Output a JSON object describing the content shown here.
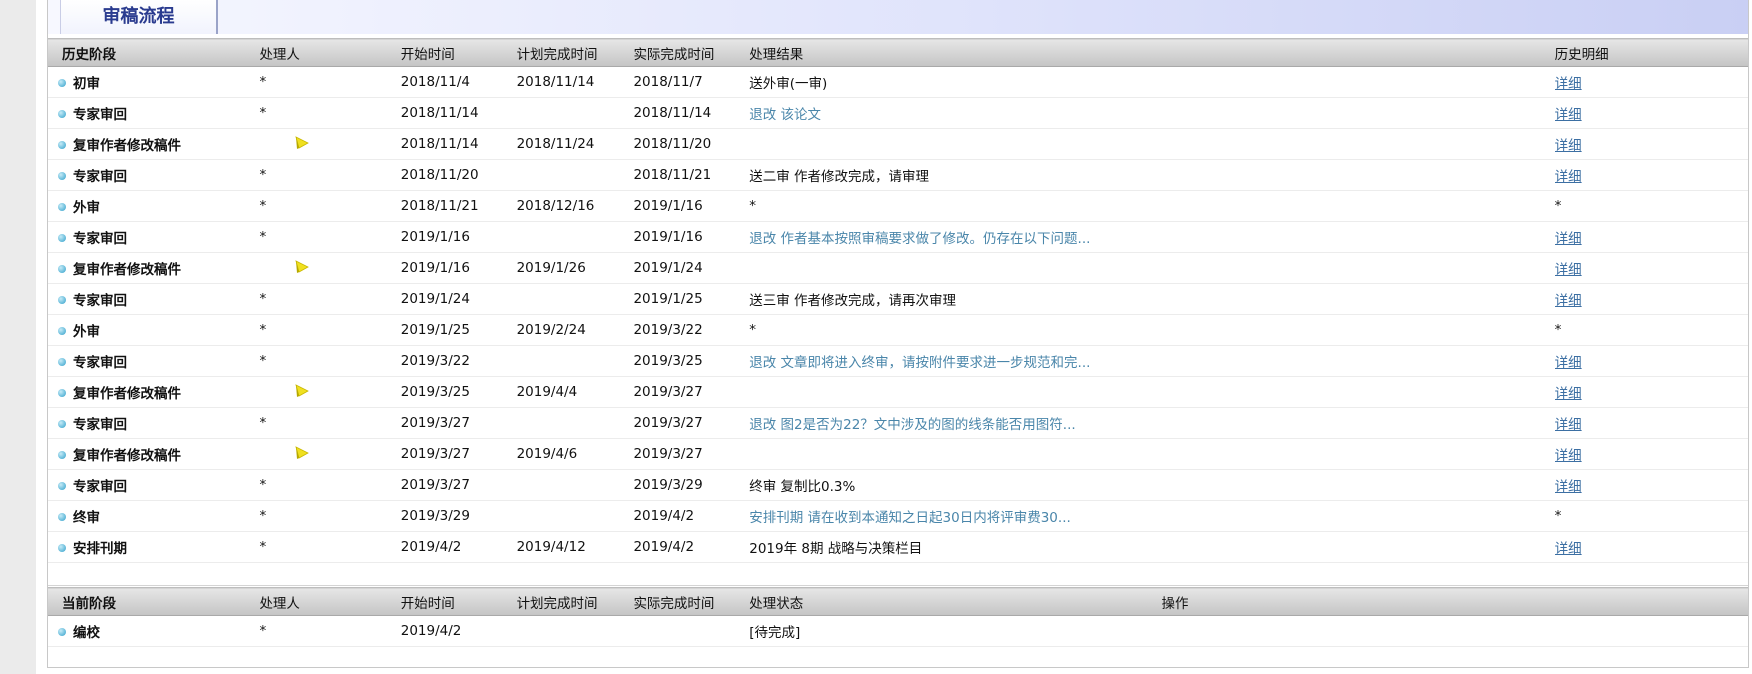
{
  "title": "审稿流程",
  "history": {
    "headers": [
      "历史阶段",
      "处理人",
      "开始时间",
      "计划完成时间",
      "实际完成时间",
      "处理结果",
      "历史明细"
    ],
    "rows": [
      {
        "stage": "初审",
        "handler": "*",
        "start": "2018/11/4",
        "plan": "2018/11/14",
        "actual": "2018/11/7",
        "result": "送外审(一审)",
        "result_link": false,
        "detail": "详细",
        "detail_link": true
      },
      {
        "stage": "专家审回",
        "handler": "*",
        "start": "2018/11/14",
        "plan": "",
        "actual": "2018/11/14",
        "result": "退改 该论文",
        "result_link": true,
        "detail": "详细",
        "detail_link": true
      },
      {
        "stage": "复审作者修改稿件",
        "handler": "",
        "flag": true,
        "start": "2018/11/14",
        "plan": "2018/11/24",
        "actual": "2018/11/20",
        "result": "",
        "result_link": false,
        "detail": "详细",
        "detail_link": true
      },
      {
        "stage": "专家审回",
        "handler": "*",
        "start": "2018/11/20",
        "plan": "",
        "actual": "2018/11/21",
        "result": "送二审 作者修改完成，请审理",
        "result_link": false,
        "detail": "详细",
        "detail_link": true
      },
      {
        "stage": "外审",
        "handler": "*",
        "start": "2018/11/21",
        "plan": "2018/12/16",
        "actual": "2019/1/16",
        "result": "*",
        "result_link": false,
        "detail": "*",
        "detail_link": false
      },
      {
        "stage": "专家审回",
        "handler": "*",
        "start": "2019/1/16",
        "plan": "",
        "actual": "2019/1/16",
        "result": "退改 作者基本按照审稿要求做了修改。仍存在以下问题...",
        "result_link": true,
        "detail": "详细",
        "detail_link": true
      },
      {
        "stage": "复审作者修改稿件",
        "handler": "",
        "flag": true,
        "start": "2019/1/16",
        "plan": "2019/1/26",
        "actual": "2019/1/24",
        "result": "",
        "result_link": false,
        "detail": "详细",
        "detail_link": true
      },
      {
        "stage": "专家审回",
        "handler": "*",
        "start": "2019/1/24",
        "plan": "",
        "actual": "2019/1/25",
        "result": "送三审 作者修改完成，请再次审理",
        "result_link": false,
        "detail": "详细",
        "detail_link": true
      },
      {
        "stage": "外审",
        "handler": "*",
        "start": "2019/1/25",
        "plan": "2019/2/24",
        "actual": "2019/3/22",
        "result": "*",
        "result_link": false,
        "detail": "*",
        "detail_link": false
      },
      {
        "stage": "专家审回",
        "handler": "*",
        "start": "2019/3/22",
        "plan": "",
        "actual": "2019/3/25",
        "result": "退改 文章即将进入终审，请按附件要求进一步规范和完...",
        "result_link": true,
        "detail": "详细",
        "detail_link": true
      },
      {
        "stage": "复审作者修改稿件",
        "handler": "",
        "flag": true,
        "start": "2019/3/25",
        "plan": "2019/4/4",
        "actual": "2019/3/27",
        "result": "",
        "result_link": false,
        "detail": "详细",
        "detail_link": true
      },
      {
        "stage": "专家审回",
        "handler": "*",
        "start": "2019/3/27",
        "plan": "",
        "actual": "2019/3/27",
        "result": "退改 图2是否为22？文中涉及的图的线条能否用图符...",
        "result_link": true,
        "detail": "详细",
        "detail_link": true
      },
      {
        "stage": "复审作者修改稿件",
        "handler": "",
        "flag": true,
        "start": "2019/3/27",
        "plan": "2019/4/6",
        "actual": "2019/3/27",
        "result": "",
        "result_link": false,
        "detail": "详细",
        "detail_link": true
      },
      {
        "stage": "专家审回",
        "handler": "*",
        "start": "2019/3/27",
        "plan": "",
        "actual": "2019/3/29",
        "result": "终审 复制比0.3%",
        "result_link": false,
        "detail": "详细",
        "detail_link": true
      },
      {
        "stage": "终审",
        "handler": "*",
        "start": "2019/3/29",
        "plan": "",
        "actual": "2019/4/2",
        "result": "安排刊期 请在收到本通知之日起30日内将评审费30...",
        "result_link": true,
        "detail": "*",
        "detail_link": false
      },
      {
        "stage": "安排刊期",
        "handler": "*",
        "start": "2019/4/2",
        "plan": "2019/4/12",
        "actual": "2019/4/2",
        "result": "2019年 8期 战略与决策栏目",
        "result_link": false,
        "detail": "详细",
        "detail_link": true
      }
    ]
  },
  "current": {
    "headers": [
      "当前阶段",
      "处理人",
      "开始时间",
      "计划完成时间",
      "实际完成时间",
      "处理状态",
      "操作"
    ],
    "rows": [
      {
        "stage": "编校",
        "handler": "*",
        "start": "2019/4/2",
        "plan": "",
        "actual": "",
        "status": "[待完成]",
        "action": ""
      }
    ]
  },
  "colors": {
    "link": "#3c6fa3",
    "result_link": "#4a86aa",
    "title_text": "#2a3b8f",
    "flag": "#f0e020"
  },
  "icons": {
    "stage_bullet": "bullet-dot-icon",
    "handler_flag": "flag-icon"
  }
}
